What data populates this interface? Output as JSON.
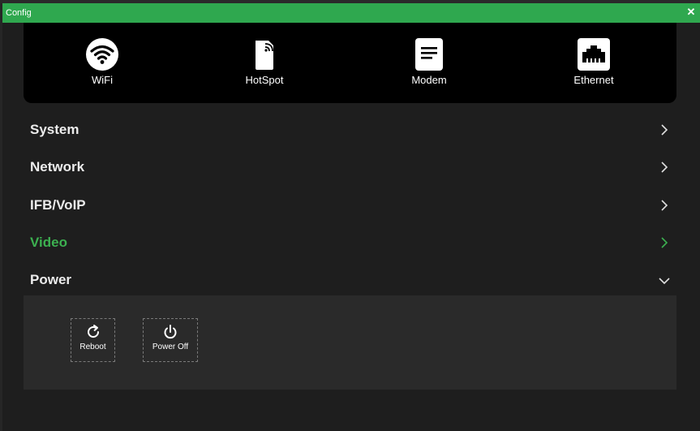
{
  "window": {
    "title": "Config",
    "close_glyph": "✕"
  },
  "connections": [
    {
      "label": "WiFi",
      "icon": "wifi-icon"
    },
    {
      "label": "HotSpot",
      "icon": "hotspot-icon"
    },
    {
      "label": "Modem",
      "icon": "modem-icon"
    },
    {
      "label": "Ethernet",
      "icon": "ethernet-icon"
    }
  ],
  "menu": [
    {
      "label": "System",
      "state": "collapsed"
    },
    {
      "label": "Network",
      "state": "collapsed"
    },
    {
      "label": "IFB/VoIP",
      "state": "collapsed"
    },
    {
      "label": "Video",
      "state": "active"
    },
    {
      "label": "Power",
      "state": "expanded"
    }
  ],
  "power": {
    "reboot_label": "Reboot",
    "poweroff_label": "Power Off"
  },
  "colors": {
    "accent": "#2fa84f",
    "active_text": "#3cb050",
    "background": "#1e1e1e",
    "panel": "#2a2a2a",
    "connection_bar": "#000000"
  }
}
